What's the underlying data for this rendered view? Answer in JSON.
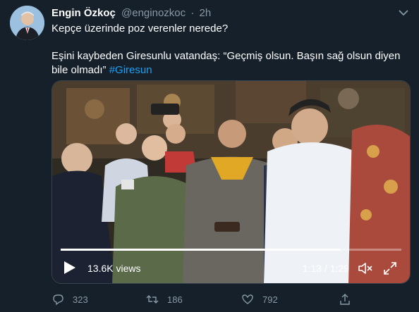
{
  "tweet": {
    "display_name": "Engin Özkoç",
    "handle": "@enginozkoc",
    "separator": "·",
    "time": "2h",
    "line1": "Kepçe üzerinde poz verenler nerede?",
    "line2": "Eşini kaybeden Giresunlu vatandaş: “Geçmiş olsun. Başın sağ olsun diyen bile olmadı”",
    "hashtag": "#Giresun"
  },
  "video": {
    "views": "13.6K views",
    "time": "1:13 / 1:29",
    "progress": 0.82
  },
  "actions": {
    "replies": "323",
    "retweets": "186",
    "likes": "792"
  },
  "icons": [
    "chevron-down-icon",
    "play-icon",
    "volume-icon",
    "fullscreen-icon",
    "reply-icon",
    "retweet-icon",
    "like-icon",
    "share-icon"
  ],
  "colors": {
    "background": "#15202b",
    "link": "#1da1f2",
    "muted": "#8899a6"
  }
}
